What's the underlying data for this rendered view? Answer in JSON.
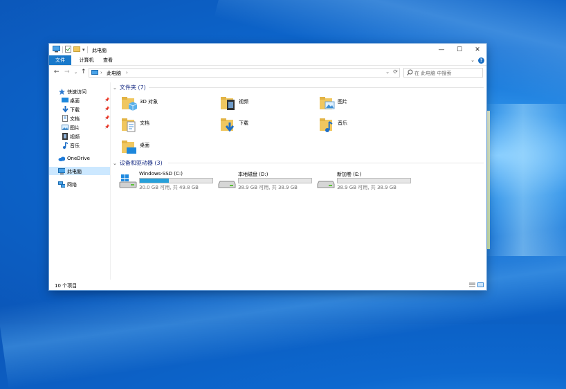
{
  "window": {
    "title": "此电脑",
    "controls": {
      "minimize": "—",
      "maximize": "☐",
      "close": "✕"
    }
  },
  "ribbon": {
    "tabs": [
      "文件",
      "计算机",
      "查看"
    ],
    "help": "?"
  },
  "address": {
    "path": "此电脑",
    "search_placeholder": "在 此电脑 中搜索"
  },
  "sidebar": {
    "items": [
      {
        "label": "快速访问",
        "icon": "star-icon",
        "pinned": false
      },
      {
        "label": "桌面",
        "icon": "desktop-icon",
        "pinned": true
      },
      {
        "label": "下载",
        "icon": "download-icon",
        "pinned": true
      },
      {
        "label": "文档",
        "icon": "document-icon",
        "pinned": true
      },
      {
        "label": "图片",
        "icon": "picture-icon",
        "pinned": true
      },
      {
        "label": "视频",
        "icon": "video-icon",
        "pinned": false
      },
      {
        "label": "音乐",
        "icon": "music-icon",
        "pinned": false
      },
      {
        "label": "OneDrive",
        "icon": "cloud-icon",
        "pinned": false
      },
      {
        "label": "此电脑",
        "icon": "pc-icon",
        "pinned": false,
        "selected": true
      },
      {
        "label": "网络",
        "icon": "network-icon",
        "pinned": false
      }
    ]
  },
  "folders_group": {
    "header": "文件夹 (7)",
    "items": [
      {
        "label": "3D 对象",
        "icon": "3d-objects-folder-icon"
      },
      {
        "label": "视频",
        "icon": "videos-folder-icon"
      },
      {
        "label": "图片",
        "icon": "pictures-folder-icon"
      },
      {
        "label": "文档",
        "icon": "documents-folder-icon"
      },
      {
        "label": "下载",
        "icon": "downloads-folder-icon"
      },
      {
        "label": "音乐",
        "icon": "music-folder-icon"
      },
      {
        "label": "桌面",
        "icon": "desktop-folder-icon"
      }
    ]
  },
  "drives_group": {
    "header": "设备和驱动器 (3)",
    "items": [
      {
        "name": "Windows-SSD (C:)",
        "free_text": "30.0 GB 可用, 共 49.8 GB",
        "used_fraction": 0.4,
        "icon": "windows-drive-icon"
      },
      {
        "name": "本地磁盘 (D:)",
        "free_text": "38.9 GB 可用, 共 38.9 GB",
        "used_fraction": 0.0,
        "icon": "hard-drive-icon"
      },
      {
        "name": "新加卷 (E:)",
        "free_text": "38.9 GB 可用, 共 38.9 GB",
        "used_fraction": 0.0,
        "icon": "hard-drive-icon"
      }
    ]
  },
  "status": {
    "count": "10 个项目"
  },
  "colors": {
    "accent": "#1979ca",
    "selection": "#cce8ff",
    "drive_bar": "#26a0da",
    "group_header": "#1e3287"
  }
}
